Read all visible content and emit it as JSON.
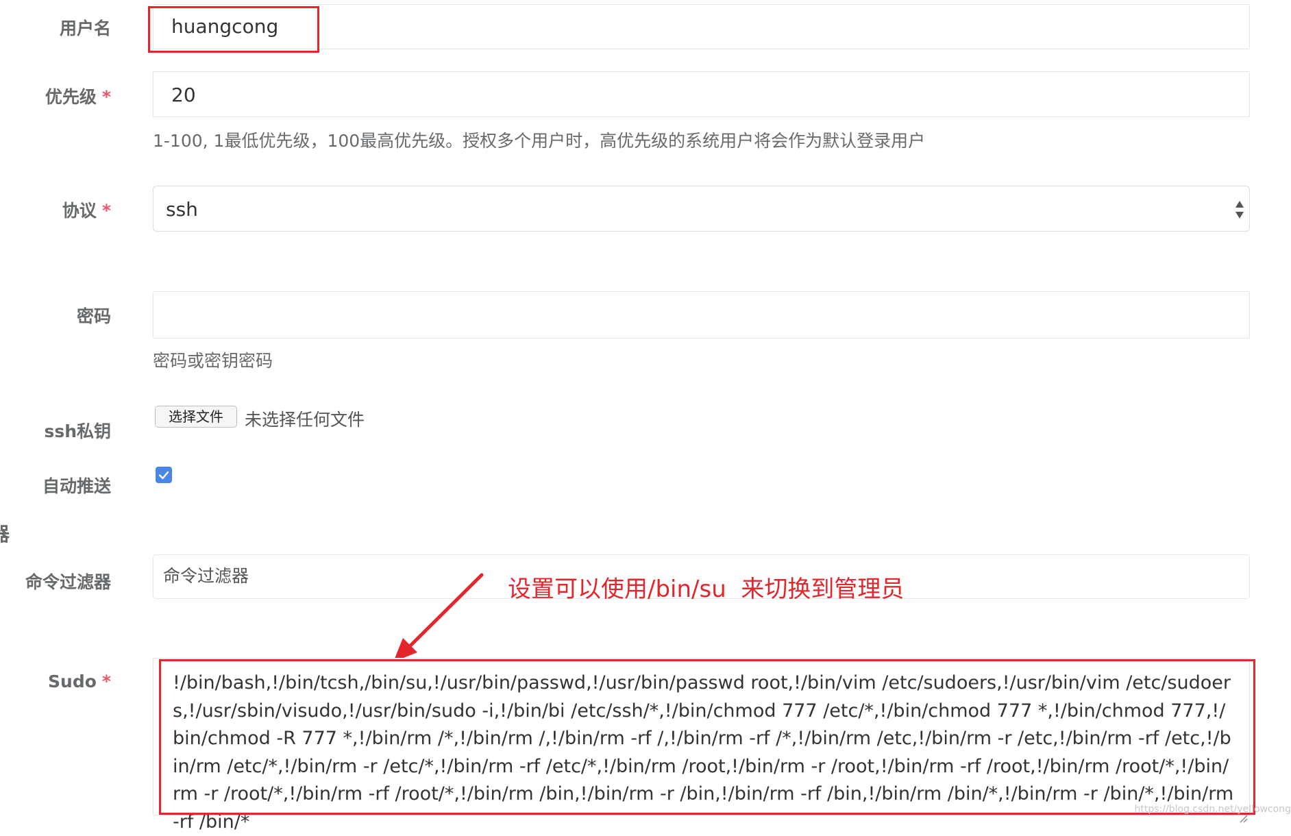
{
  "form": {
    "username": {
      "label": "用户名",
      "value": "huangcong"
    },
    "priority": {
      "label": "优先级",
      "required": "*",
      "value": "20",
      "help": "1-100, 1最低优先级，100最高优先级。授权多个用户时，高优先级的系统用户将会作为默认登录用户"
    },
    "protocol": {
      "label": "协议",
      "required": "*",
      "value": "ssh"
    },
    "password": {
      "label": "密码",
      "value": "",
      "help": "密码或密钥密码"
    },
    "ssh_key": {
      "label": "ssh私钥",
      "button": "选择文件",
      "status": "未选择任何文件"
    },
    "auto_push": {
      "label": "自动推送",
      "checked": true
    },
    "section_fragment": "器",
    "cmd_filter": {
      "label": "命令过滤器",
      "placeholder": "命令过滤器"
    },
    "sudo": {
      "label": "Sudo",
      "required": "*",
      "value": "!/bin/bash,!/bin/tcsh,/bin/su,!/usr/bin/passwd,!/usr/bin/passwd root,!/bin/vim /etc/sudoers,!/usr/bin/vim /etc/sudoers,!/usr/sbin/visudo,!/usr/bin/sudo -i,!/bin/bi /etc/ssh/*,!/bin/chmod 777 /etc/*,!/bin/chmod 777 *,!/bin/chmod 777,!/bin/chmod -R 777 *,!/bin/rm /*,!/bin/rm /,!/bin/rm -rf /,!/bin/rm -rf /*,!/bin/rm /etc,!/bin/rm -r /etc,!/bin/rm -rf /etc,!/bin/rm /etc/*,!/bin/rm -r /etc/*,!/bin/rm -rf /etc/*,!/bin/rm /root,!/bin/rm -r /root,!/bin/rm -rf /root,!/bin/rm /root/*,!/bin/rm -r /root/*,!/bin/rm -rf /root/*,!/bin/rm /bin,!/bin/rm -r /bin,!/bin/rm -rf /bin,!/bin/rm /bin/*,!/bin/rm -r /bin/*,!/bin/rm -rf /bin/*"
    }
  },
  "annotation": {
    "text": "设置可以使用/bin/su  来切换到管理员",
    "color": "#e4262c"
  },
  "watermark": "https://blog.csdn.net/yellowcong",
  "colors": {
    "required": "#ed5565",
    "border": "#e5e6e7",
    "checkbox": "#4a86e8",
    "annotation": "#e4262c"
  }
}
